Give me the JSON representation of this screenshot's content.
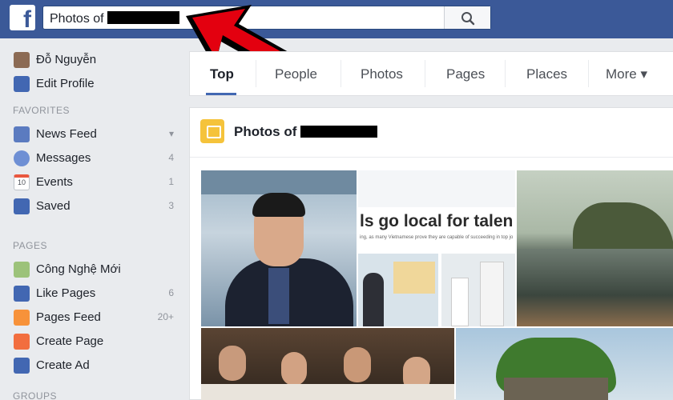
{
  "topbar": {
    "logo": "f",
    "search_value": "Photos of",
    "search_icon": "search-icon"
  },
  "sidebar": {
    "profile": {
      "name": "Đỗ Nguyễn",
      "edit": "Edit Profile"
    },
    "favorites_title": "FAVORITES",
    "favorites": [
      {
        "label": "News Feed",
        "count": "▾"
      },
      {
        "label": "Messages",
        "count": "4"
      },
      {
        "label": "Events",
        "count": "1"
      },
      {
        "label": "Saved",
        "count": "3"
      }
    ],
    "events_icon_text": "10",
    "pages_title": "PAGES",
    "pages": [
      {
        "label": "Công Nghệ Mới",
        "count": ""
      },
      {
        "label": "Like Pages",
        "count": "6"
      },
      {
        "label": "Pages Feed",
        "count": "20+"
      },
      {
        "label": "Create Page",
        "count": ""
      },
      {
        "label": "Create Ad",
        "count": ""
      }
    ],
    "groups_title": "GROUPS"
  },
  "tabs": [
    "Top",
    "People",
    "Photos",
    "Pages",
    "Places",
    "More ▾"
  ],
  "results": {
    "title": "Photos of",
    "banner_text": "ls go local for talen",
    "banner_small": "ing, as many Vietnamese prove they are capable of succeeding in top jo"
  },
  "colors": {
    "brand": "#3b5998",
    "accent": "#4267b2",
    "annotation": "#e3000f"
  }
}
